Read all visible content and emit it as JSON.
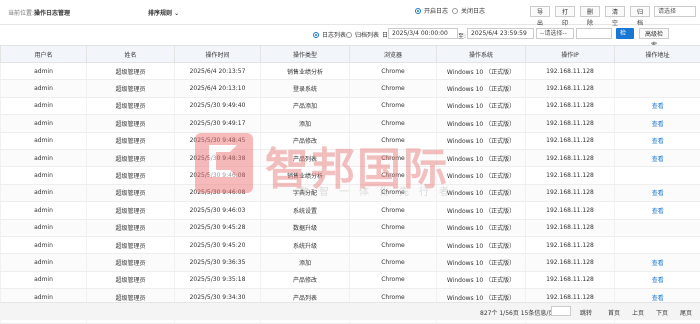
{
  "header": {
    "crumb_prefix": "当前位置:",
    "crumb_current": "操作日志管理",
    "sort_label": "排序规则",
    "log_on_label": "开启日志",
    "log_off_label": "关闭日志",
    "buttons": [
      "导出",
      "打印",
      "删除",
      "清空",
      "归档"
    ],
    "select_placeholder": "请选择"
  },
  "filter": {
    "log_list_label": "日志列表",
    "archive_list_label": "归档列表",
    "date_label": "日:",
    "start": "2025/3/4 00:00:00",
    "to_label": "至:",
    "end": "2025/6/4 23:59:59",
    "select": "--请选择--",
    "search": "检索",
    "advanced": "高级检索"
  },
  "table": {
    "headers": [
      "用户名",
      "姓名",
      "操作时间",
      "操作类型",
      "浏览器",
      "操作系统",
      "操作IP",
      "操作地址"
    ],
    "rows": [
      [
        "admin",
        "超级管理员",
        "2025/6/4 20:13:57",
        "销售业绩分析",
        "Chrome",
        "Windows 10 （正式版）",
        "192.168.11.128",
        ""
      ],
      [
        "admin",
        "超级管理员",
        "2025/6/4 20:13:10",
        "登录系统",
        "Chrome",
        "Windows 10 （正式版）",
        "192.168.11.128",
        ""
      ],
      [
        "admin",
        "超级管理员",
        "2025/5/30 9:49:40",
        "产品添加",
        "Chrome",
        "Windows 10 （正式版）",
        "192.168.11.128",
        "查看"
      ],
      [
        "admin",
        "超级管理员",
        "2025/5/30 9:49:17",
        "添加",
        "Chrome",
        "Windows 10 （正式版）",
        "192.168.11.128",
        "查看"
      ],
      [
        "admin",
        "超级管理员",
        "2025/5/30 9:48:45",
        "产品修改",
        "Chrome",
        "Windows 10 （正式版）",
        "192.168.11.128",
        "查看"
      ],
      [
        "admin",
        "超级管理员",
        "2025/5/30 9:48:38",
        "产品列表",
        "Chrome",
        "Windows 10 （正式版）",
        "192.168.11.128",
        "查看"
      ],
      [
        "admin",
        "超级管理员",
        "2025/5/30 9:46:08",
        "销售业绩分析",
        "Chrome",
        "Windows 10 （正式版）",
        "192.168.11.128",
        ""
      ],
      [
        "admin",
        "超级管理员",
        "2025/5/30 9:46:08",
        "字典分配",
        "Chrome",
        "Windows 10 （正式版）",
        "192.168.11.128",
        "查看"
      ],
      [
        "admin",
        "超级管理员",
        "2025/5/30 9:46:03",
        "系统设置",
        "Chrome",
        "Windows 10 （正式版）",
        "192.168.11.128",
        "查看"
      ],
      [
        "admin",
        "超级管理员",
        "2025/5/30 9:45:28",
        "数据升级",
        "Chrome",
        "Windows 10 （正式版）",
        "192.168.11.128",
        ""
      ],
      [
        "admin",
        "超级管理员",
        "2025/5/30 9:45:20",
        "系统升级",
        "Chrome",
        "Windows 10 （正式版）",
        "192.168.11.128",
        ""
      ],
      [
        "admin",
        "超级管理员",
        "2025/5/30 9:36:35",
        "添加",
        "Chrome",
        "Windows 10 （正式版）",
        "192.168.11.128",
        "查看"
      ],
      [
        "admin",
        "超级管理员",
        "2025/5/30 9:35:18",
        "产品修改",
        "Chrome",
        "Windows 10 （正式版）",
        "192.168.11.128",
        "查看"
      ],
      [
        "admin",
        "超级管理员",
        "2025/5/30 9:34:30",
        "产品列表",
        "Chrome",
        "Windows 10 （正式版）",
        "192.168.11.128",
        "查看"
      ],
      [
        "admin",
        "超级管理员",
        "2025/5/30 9:05:44",
        "销售业绩分析",
        "Chrome",
        "Windows 10 （正式版）",
        "192.168.11.128",
        ""
      ]
    ]
  },
  "watermark": {
    "main": "智邦国际",
    "sub": "数智一体化先行者"
  },
  "footer": {
    "summary": "827个 1/56页 15条信息/页",
    "goto": "跳转",
    "first": "首页",
    "prev": "上页",
    "next": "下页",
    "last": "尾页"
  },
  "colors": {
    "accent": "#1976d2",
    "watermark": "#e77"
  }
}
